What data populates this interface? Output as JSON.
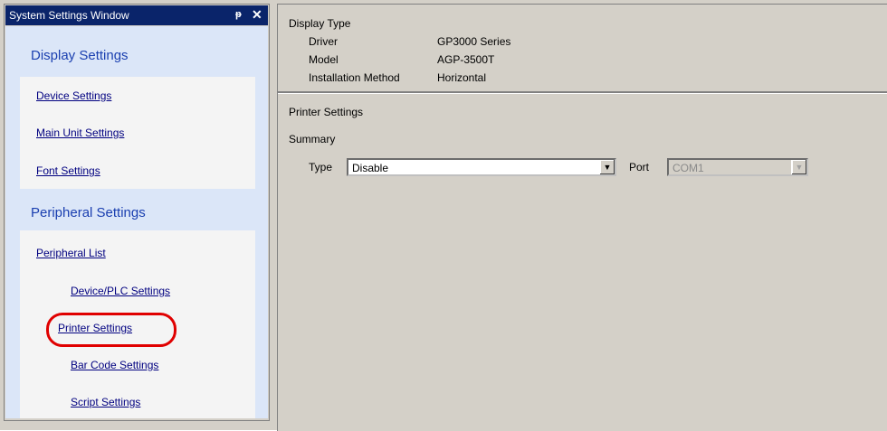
{
  "window": {
    "title": "System Settings Window",
    "pin_glyph": "ᵽ",
    "close_glyph": "✕"
  },
  "sidebar": {
    "display_section_title": "Display Settings",
    "display_items": [
      {
        "label": "Device Settings"
      },
      {
        "label": "Main Unit Settings"
      },
      {
        "label": "Font Settings"
      }
    ],
    "peripheral_section_title": "Peripheral Settings",
    "peripheral_items": [
      {
        "label": "Peripheral List"
      },
      {
        "label": "Device/PLC Settings"
      },
      {
        "label": "Printer Settings"
      },
      {
        "label": "Bar Code Settings"
      },
      {
        "label": "Script Settings"
      }
    ]
  },
  "display_type": {
    "title": "Display Type",
    "rows": [
      {
        "key": "Driver",
        "value": "GP3000 Series"
      },
      {
        "key": "Model",
        "value": "AGP-3500T"
      },
      {
        "key": "Installation Method",
        "value": "Horizontal"
      }
    ]
  },
  "printer": {
    "title": "Printer Settings",
    "summary_label": "Summary",
    "type_label": "Type",
    "type_value": "Disable",
    "port_label": "Port",
    "port_value": "COM1"
  },
  "colors": {
    "titlebar": "#0a246a",
    "sidebar_bg": "#dbe6f8",
    "section_heading": "#1a3fb0",
    "link": "#000080",
    "highlight": "#e00000"
  }
}
